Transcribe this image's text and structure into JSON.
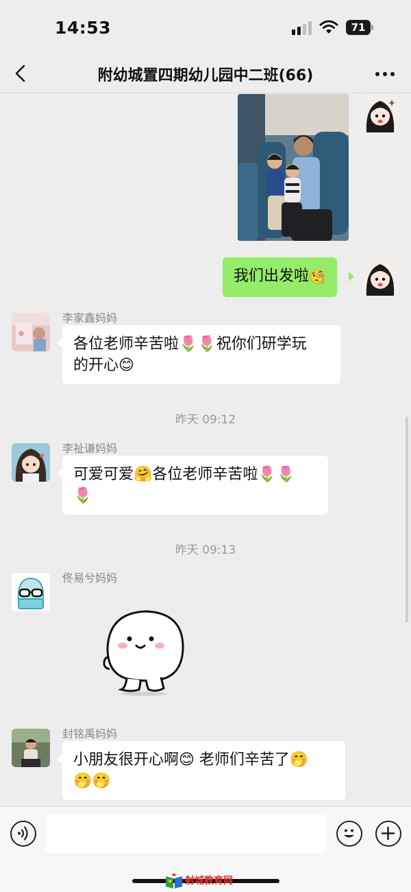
{
  "status_bar": {
    "time": "14:53",
    "battery": "71"
  },
  "header": {
    "title": "附幼城置四期幼儿园中二班(66)"
  },
  "messages": [
    {
      "type": "image",
      "from": "self"
    },
    {
      "type": "text",
      "from": "self",
      "text": "我们出发啦",
      "emoji": "🧐"
    },
    {
      "type": "text",
      "from": "other",
      "sender": "李家鑫妈妈",
      "line1": "各位老师辛苦啦🌷🌷祝你们研学玩",
      "line2": "的开心😊"
    },
    {
      "type": "time",
      "label": "昨天 09:12"
    },
    {
      "type": "text",
      "from": "other",
      "sender": "李祉谦妈妈",
      "line1": "可爱可爱🤗各位老师辛苦啦🌷🌷",
      "line2": "🌷"
    },
    {
      "type": "time",
      "label": "昨天 09:13"
    },
    {
      "type": "sticker",
      "from": "other",
      "sender": "佟易兮妈妈"
    },
    {
      "type": "text",
      "from": "other",
      "sender": "封铭禹妈妈",
      "line1": "小朋友很开心啊😊 老师们辛苦了🤭",
      "line2": "🤭🤭"
    }
  ],
  "input_bar": {
    "placeholder": ""
  },
  "watermark": {
    "text": "射城教育网"
  },
  "icons": {
    "back": "chevron-left-icon",
    "more": "more-dots-icon",
    "voice": "voice-icon",
    "emoji": "emoji-smile-icon",
    "plus": "plus-icon"
  },
  "colors": {
    "background": "#ededed",
    "self_bubble": "#95ec69",
    "other_bubble": "#ffffff",
    "watermark": "#e0352b"
  }
}
